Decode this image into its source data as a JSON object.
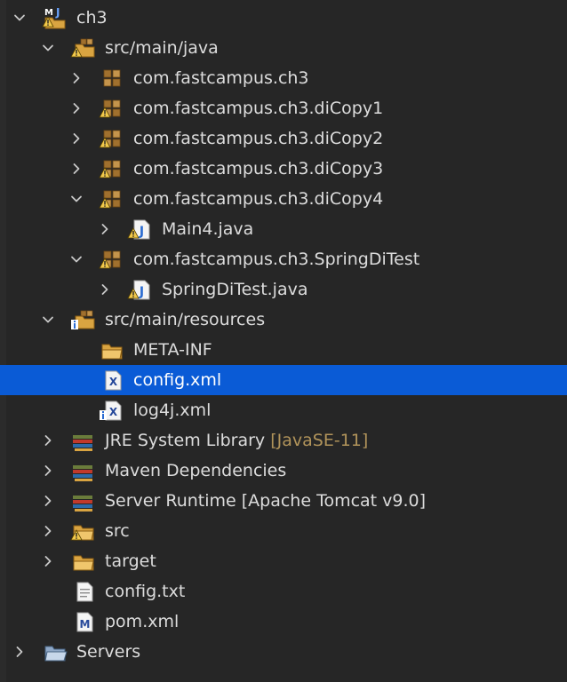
{
  "tree": {
    "rows": [
      {
        "label": "ch3",
        "decor": "",
        "icon": "maven-java-project-icon",
        "chevron": "expanded",
        "level": 0
      },
      {
        "label": "src/main/java",
        "decor": "",
        "icon": "source-folder-icon",
        "chevron": "expanded",
        "level": 1
      },
      {
        "label": "com.fastcampus.ch3",
        "decor": "",
        "icon": "package-icon",
        "chevron": "collapsed",
        "level": 2
      },
      {
        "label": "com.fastcampus.ch3.diCopy1",
        "decor": "",
        "icon": "package-warning-icon",
        "chevron": "collapsed",
        "level": 2
      },
      {
        "label": "com.fastcampus.ch3.diCopy2",
        "decor": "",
        "icon": "package-warning-icon",
        "chevron": "collapsed",
        "level": 2
      },
      {
        "label": "com.fastcampus.ch3.diCopy3",
        "decor": "",
        "icon": "package-warning-icon",
        "chevron": "collapsed",
        "level": 2
      },
      {
        "label": "com.fastcampus.ch3.diCopy4",
        "decor": "",
        "icon": "package-warning-icon",
        "chevron": "expanded",
        "level": 2
      },
      {
        "label": "Main4.java",
        "decor": "",
        "icon": "java-file-warning-icon",
        "chevron": "collapsed",
        "level": 3
      },
      {
        "label": "com.fastcampus.ch3.SpringDiTest",
        "decor": "",
        "icon": "package-warning-icon",
        "chevron": "expanded",
        "level": 2
      },
      {
        "label": "SpringDiTest.java",
        "decor": "",
        "icon": "java-file-warning-icon",
        "chevron": "collapsed",
        "level": 3
      },
      {
        "label": "src/main/resources",
        "decor": "",
        "icon": "resource-folder-icon",
        "chevron": "expanded",
        "level": 1
      },
      {
        "label": "META-INF",
        "decor": "",
        "icon": "folder-icon",
        "chevron": "none",
        "level": 2
      },
      {
        "label": "config.xml",
        "decor": "",
        "icon": "xml-file-icon",
        "chevron": "none",
        "level": 2,
        "selected": true
      },
      {
        "label": "log4j.xml",
        "decor": "",
        "icon": "xml-file-info-icon",
        "chevron": "none",
        "level": 2
      },
      {
        "label": "JRE System Library",
        "decor": "[JavaSE-11]",
        "icon": "library-icon",
        "chevron": "collapsed",
        "level": 1
      },
      {
        "label": "Maven Dependencies",
        "decor": "",
        "icon": "library-icon",
        "chevron": "collapsed",
        "level": 1
      },
      {
        "label": "Server Runtime [Apache Tomcat v9.0]",
        "decor": "",
        "icon": "library-icon",
        "chevron": "collapsed",
        "level": 1
      },
      {
        "label": "src",
        "decor": "",
        "icon": "folder-warning-icon",
        "chevron": "collapsed",
        "level": 1
      },
      {
        "label": "target",
        "decor": "",
        "icon": "folder-icon",
        "chevron": "collapsed",
        "level": 1
      },
      {
        "label": "config.txt",
        "decor": "",
        "icon": "text-file-icon",
        "chevron": "none",
        "level": 1
      },
      {
        "label": "pom.xml",
        "decor": "",
        "icon": "maven-pom-icon",
        "chevron": "none",
        "level": 1
      },
      {
        "label": "Servers",
        "decor": "",
        "icon": "servers-folder-icon",
        "chevron": "collapsed",
        "level": 0
      }
    ]
  },
  "colors": {
    "background": "#262626",
    "selection": "#0a5bd6",
    "text": "#dcdcdc",
    "decoration": "#b0935a"
  }
}
